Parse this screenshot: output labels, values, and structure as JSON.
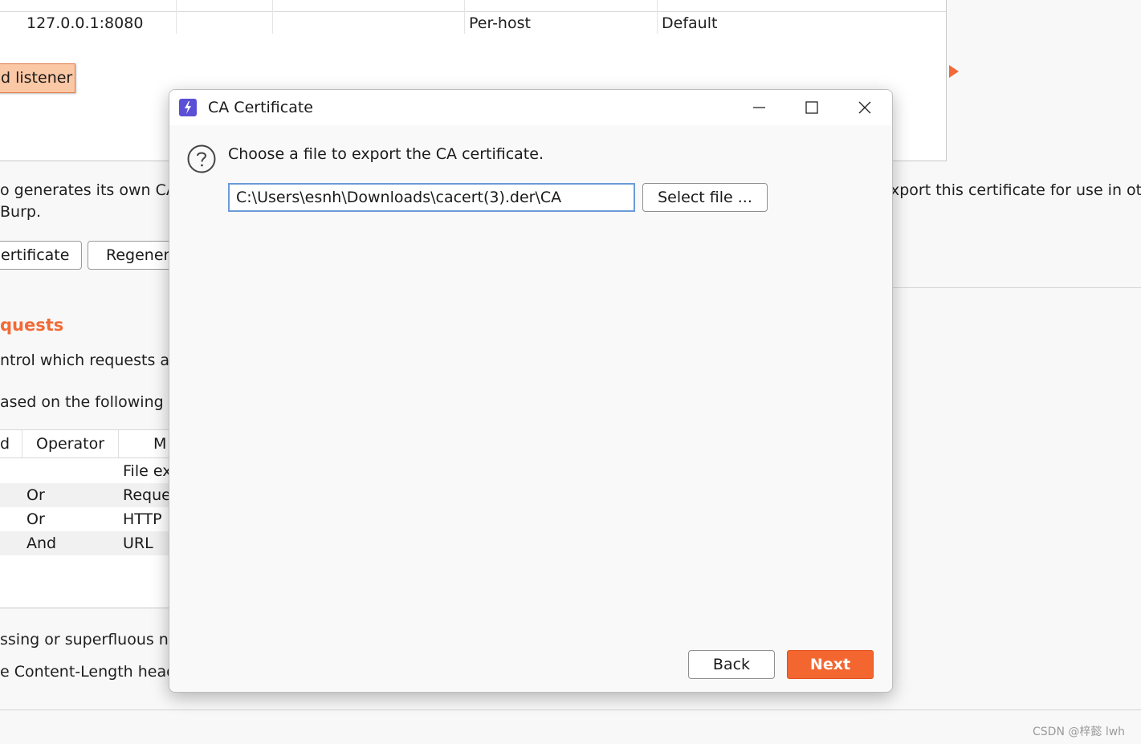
{
  "background": {
    "listener_table": {
      "row": {
        "interface": "127.0.0.1:8080",
        "certificate": "Per-host",
        "tls_protocols": "Default"
      }
    },
    "add_listener_label": "d listener",
    "ca_text_left_1": "o generates its own CA",
    "ca_text_left_2": "Burp.",
    "ca_text_right": "xport this certificate for use in oth",
    "export_button": "ertificate",
    "regenerate_button": "Regener",
    "section_title": "quests",
    "intercept_text_1": "ntrol which requests a",
    "intercept_text_2": "ased on the following",
    "rules_table": {
      "headers": [
        "d",
        "Operator",
        "M"
      ],
      "rows": [
        {
          "operator": "",
          "match": "File ex"
        },
        {
          "operator": "Or",
          "match": "Reque"
        },
        {
          "operator": "Or",
          "match": "HTTP"
        },
        {
          "operator": "And",
          "match": "URL"
        }
      ]
    },
    "bottom_text_1": "ssing or superfluous ne",
    "bottom_text_2": "e Content-Length head"
  },
  "dialog": {
    "title": "CA Certificate",
    "icons": {
      "app": "burp-lightning-icon",
      "help": "question-circle-icon",
      "minimize": "minimize-icon",
      "maximize": "maximize-icon",
      "close": "close-icon"
    },
    "prompt": "Choose a file to export the CA certificate.",
    "path_value": "C:\\Users\\esnh\\Downloads\\cacert(3).der\\CA",
    "select_file_label": "Select file ...",
    "back_label": "Back",
    "next_label": "Next",
    "accent_color": "#f4662f"
  },
  "watermark": "CSDN @梓懿 lwh"
}
